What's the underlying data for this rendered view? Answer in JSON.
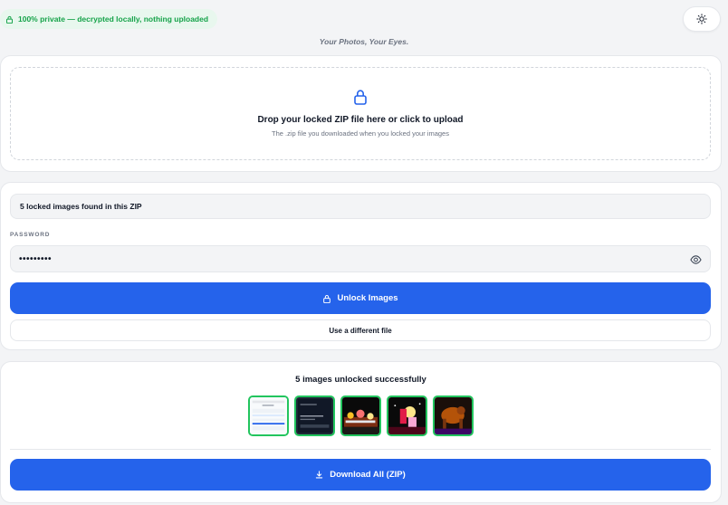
{
  "header": {
    "privacy_badge": "100% private — decrypted locally, nothing uploaded",
    "tagline": "Your Photos, Your Eyes.",
    "theme_toggle_icon": "sun-icon"
  },
  "upload": {
    "icon": "lock-icon",
    "title": "Drop your locked ZIP file here or click to upload",
    "subtitle": "The .zip file you downloaded when you locked your images"
  },
  "form": {
    "found_text": "5 locked images found in this ZIP",
    "password_label": "PASSWORD",
    "password_value": "•••••••••",
    "reveal_icon": "eye-icon",
    "unlock_label": "Unlock Images",
    "different_file_label": "Use a different file"
  },
  "result": {
    "title": "5 images unlocked successfully",
    "thumbnails": [
      "thumbnail-1",
      "thumbnail-2",
      "thumbnail-3",
      "thumbnail-4",
      "thumbnail-5"
    ],
    "download_label": "Download All (ZIP)"
  },
  "colors": {
    "accent": "#2563eb",
    "success": "#22c55e",
    "privacy_text": "#16a34a",
    "background": "#f3f4f6"
  }
}
